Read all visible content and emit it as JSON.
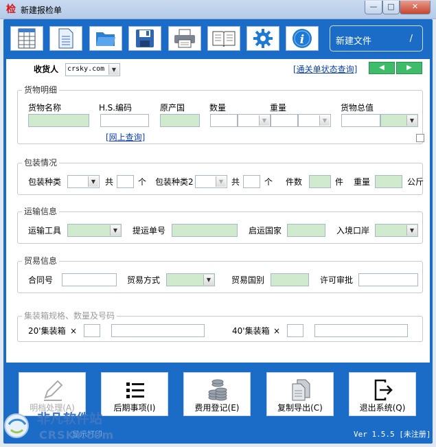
{
  "window": {
    "title": "新建报检单",
    "app_icon_text": "检",
    "minimize": "—",
    "maximize": "□",
    "close": "✕"
  },
  "toolbar": {
    "items": [
      {
        "name": "spreadsheet-icon"
      },
      {
        "name": "document-icon"
      },
      {
        "name": "folder-open-icon"
      },
      {
        "name": "save-icon"
      },
      {
        "name": "printer-icon"
      },
      {
        "name": "book-icon"
      },
      {
        "name": "gear-icon"
      },
      {
        "name": "info-icon"
      }
    ],
    "newfile_label": "新建文件",
    "newfile_slash": "/"
  },
  "receiver": {
    "label": "收货人",
    "value": "crsky.com",
    "query_link": "[通关单状态查询]"
  },
  "goods": {
    "legend": "货物明细",
    "name_label": "货物名称",
    "hs_label": "H.S.编码",
    "origin_label": "原产国",
    "qty_label": "数量",
    "weight_label": "重量",
    "total_label": "货物总值",
    "online_link": "[网上查询]"
  },
  "packing": {
    "legend": "包装情况",
    "type_label": "包装种类",
    "total1": "共",
    "unit1": "个",
    "type2_label": "包装种类2",
    "total2": "共",
    "unit2": "个",
    "count_label": "件数",
    "count_unit": "件",
    "weight_label": "重量",
    "weight_unit": "公斤"
  },
  "transport": {
    "legend": "运输信息",
    "tool_label": "运输工具",
    "bill_label": "提运单号",
    "country_label": "启运国家",
    "port_label": "入境口岸"
  },
  "trade": {
    "legend": "贸易信息",
    "contract_label": "合同号",
    "mode_label": "贸易方式",
    "country_label": "贸易国别",
    "permit_label": "许可审批"
  },
  "container": {
    "legend": "集装箱规格、数量及号码",
    "c20_label": "20'集装箱",
    "c40_label": "40'集装箱",
    "times": "×"
  },
  "actions": [
    {
      "label": "明档处理(A)",
      "icon": "pencil-icon",
      "disabled": true
    },
    {
      "label": "后期事项(I)",
      "icon": "list-icon",
      "disabled": false
    },
    {
      "label": "费用登记(E)",
      "icon": "coins-icon",
      "disabled": false
    },
    {
      "label": "复制导出(C)",
      "icon": "copy-export-icon",
      "disabled": false
    },
    {
      "label": "退出系统(Q)",
      "icon": "exit-icon",
      "disabled": false
    }
  ],
  "status": {
    "version": "Ver 1.5.5 [未注册]",
    "left_text": "显示打印",
    "watermark_cn": "非凡软件站",
    "watermark_en": "CRSKY.com"
  },
  "colors": {
    "accent": "#1a6cc7",
    "field_green": "#cfeacd",
    "link": "#0b3fa8"
  }
}
